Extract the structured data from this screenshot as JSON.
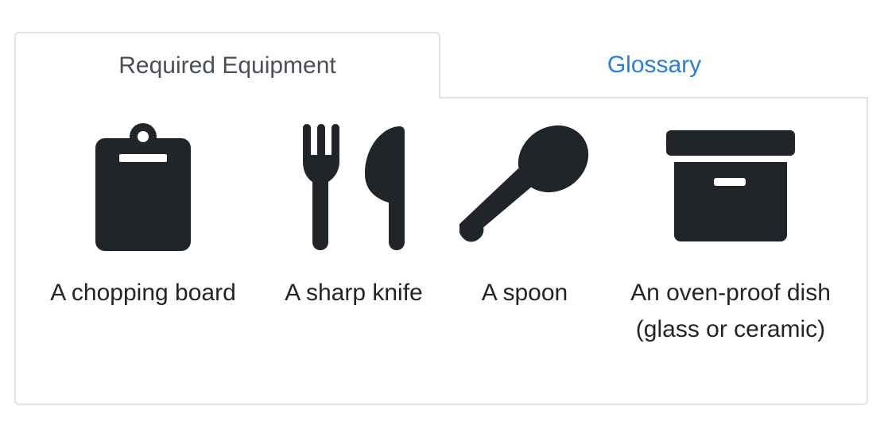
{
  "tabs": [
    {
      "label": "Required Equipment",
      "active": true
    },
    {
      "label": "Glossary",
      "active": false
    }
  ],
  "equipment": [
    {
      "label": "A chopping board",
      "icon": "clipboard-icon"
    },
    {
      "label": "A sharp knife",
      "icon": "utensils-icon"
    },
    {
      "label": "A spoon",
      "icon": "spoon-icon"
    },
    {
      "label_line1": "An oven-proof dish",
      "label_line2": "(glass or ceramic)",
      "icon": "box-dish-icon"
    }
  ],
  "colors": {
    "icon": "#212529",
    "active_tab_text": "#495057",
    "link": "#2a7de1",
    "border": "#dee2e6"
  }
}
